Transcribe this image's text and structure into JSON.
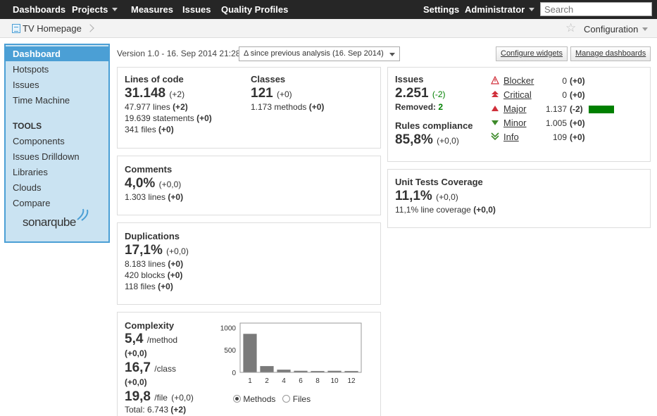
{
  "nav": {
    "dashboards": "Dashboards",
    "projects": "Projects",
    "measures": "Measures",
    "issues": "Issues",
    "quality_profiles": "Quality Profiles",
    "settings": "Settings",
    "user": "Administrator",
    "search_placeholder": "Search"
  },
  "breadcrumb": {
    "project": "TV Homepage",
    "configuration": "Configuration"
  },
  "sidebar": {
    "items": [
      "Dashboard",
      "Hotspots",
      "Issues",
      "Time Machine"
    ],
    "tools_heading": "TOOLS",
    "tools": [
      "Components",
      "Issues Drilldown",
      "Libraries",
      "Clouds",
      "Compare"
    ],
    "logo": "sonarqube"
  },
  "header": {
    "version": "Version 1.0 - 16. Sep 2014 21:28",
    "period": "Δ since previous analysis (16. Sep 2014)",
    "configure_widgets": "Configure widgets",
    "manage_dashboards": "Manage dashboards"
  },
  "size": {
    "loc_title": "Lines of code",
    "loc_value": "31.148",
    "loc_delta": "(+2)",
    "lines": "47.977 lines",
    "lines_delta": "(+2)",
    "statements": "19.639 statements",
    "statements_delta": "(+0)",
    "files": "341 files",
    "files_delta": "(+0)",
    "classes_title": "Classes",
    "classes_value": "121",
    "classes_delta": "(+0)",
    "methods": "1.173 methods",
    "methods_delta": "(+0)"
  },
  "comments": {
    "title": "Comments",
    "value": "4,0%",
    "delta": "(+0,0)",
    "lines": "1.303 lines",
    "lines_delta": "(+0)"
  },
  "duplications": {
    "title": "Duplications",
    "value": "17,1%",
    "delta": "(+0,0)",
    "lines": "8.183 lines",
    "lines_delta": "(+0)",
    "blocks": "420 blocks",
    "blocks_delta": "(+0)",
    "files": "118 files",
    "files_delta": "(+0)"
  },
  "complexity": {
    "title": "Complexity",
    "per_method": "5,4",
    "per_method_unit": "/method",
    "per_method_delta": "(+0,0)",
    "per_class": "16,7",
    "per_class_unit": "/class",
    "per_class_delta": "(+0,0)",
    "per_file": "19,8",
    "per_file_unit": "/file",
    "per_file_delta": "(+0,0)",
    "total_label": "Total: 6.743",
    "total_delta": "(+2)",
    "radio_methods": "Methods",
    "radio_files": "Files"
  },
  "issues": {
    "title": "Issues",
    "value": "2.251",
    "delta": "(-2)",
    "removed_label": "Removed:",
    "removed_value": "2",
    "compliance_title": "Rules compliance",
    "compliance_value": "85,8%",
    "compliance_delta": "(+0,0)",
    "severities": [
      {
        "name": "Blocker",
        "count": "0",
        "delta": "(+0)",
        "icon": "blocker-icon"
      },
      {
        "name": "Critical",
        "count": "0",
        "delta": "(+0)",
        "icon": "critical-icon"
      },
      {
        "name": "Major",
        "count": "1.137",
        "delta": "(-2)",
        "icon": "major-icon",
        "bar_fraction": 1.0
      },
      {
        "name": "Minor",
        "count": "1.005",
        "delta": "(+0)",
        "icon": "minor-icon"
      },
      {
        "name": "Info",
        "count": "109",
        "delta": "(+0)",
        "icon": "info-icon"
      }
    ]
  },
  "coverage": {
    "title": "Unit Tests Coverage",
    "value": "11,1%",
    "delta": "(+0,0)",
    "line_coverage": "11,1% line coverage",
    "line_coverage_delta": "(+0,0)"
  },
  "colors": {
    "accent": "#4b9fd5",
    "sidebar_bg": "#cae3f2",
    "nav_bg": "#262626",
    "bar": "#7a7a7a",
    "green": "#008000"
  },
  "chart_data": {
    "type": "bar",
    "categories": [
      "1",
      "2",
      "4",
      "6",
      "8",
      "10",
      "12"
    ],
    "values": [
      860,
      140,
      60,
      35,
      30,
      35,
      30
    ],
    "yticks": [
      "0",
      "500",
      "1000"
    ],
    "ylim": [
      0,
      1100
    ],
    "title": "",
    "xlabel": "",
    "ylabel": ""
  }
}
